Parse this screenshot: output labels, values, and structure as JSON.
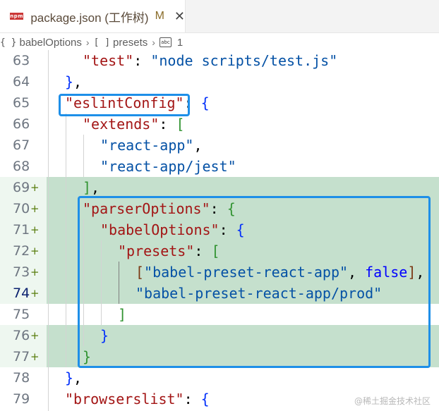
{
  "tab": {
    "icon_text": "npm",
    "title": "package.json (工作树)",
    "modified": "M",
    "close": "✕"
  },
  "breadcrumb": [
    {
      "icon": "{ }",
      "label": "babelOptions"
    },
    {
      "icon": "[ ]",
      "label": "presets"
    },
    {
      "icon": "abc",
      "label": "1"
    }
  ],
  "lines": [
    {
      "num": "63",
      "added": false,
      "active": false
    },
    {
      "num": "64",
      "added": false,
      "active": false
    },
    {
      "num": "65",
      "added": false,
      "active": false
    },
    {
      "num": "66",
      "added": false,
      "active": false
    },
    {
      "num": "67",
      "added": false,
      "active": false
    },
    {
      "num": "68",
      "added": false,
      "active": false
    },
    {
      "num": "69",
      "added": true,
      "active": false
    },
    {
      "num": "70",
      "added": true,
      "active": false
    },
    {
      "num": "71",
      "added": true,
      "active": false
    },
    {
      "num": "72",
      "added": true,
      "active": false
    },
    {
      "num": "73",
      "added": true,
      "active": false
    },
    {
      "num": "74",
      "added": true,
      "active": true
    },
    {
      "num": "75",
      "added": false,
      "active": false
    },
    {
      "num": "76",
      "added": true,
      "active": false
    },
    {
      "num": "77",
      "added": true,
      "active": false
    },
    {
      "num": "78",
      "added": false,
      "active": false
    },
    {
      "num": "79",
      "added": false,
      "active": false
    }
  ],
  "code": {
    "test_key": "\"test\"",
    "test_val": "\"node scripts/test.js\"",
    "eslint_key": "\"eslintConfig\"",
    "extends_key": "\"extends\"",
    "react_app": "\"react-app\"",
    "react_app_jest": "\"react-app/jest\"",
    "parser_key": "\"parserOptions\"",
    "babel_key": "\"babelOptions\"",
    "presets_key": "\"presets\"",
    "preset1": "\"babel-preset-react-app\"",
    "false_kw": "false",
    "preset2": "\"babel-preset-react-app/prod\"",
    "browsers_key": "\"browserslist\""
  },
  "plus_marker": "+",
  "watermark": "@稀土掘金技术社区",
  "colors": {
    "added_bg": "#c5e0cd",
    "highlight_box": "#1e8fe8",
    "key": "#a31515",
    "string": "#0451a5",
    "keyword": "#0000ff"
  }
}
